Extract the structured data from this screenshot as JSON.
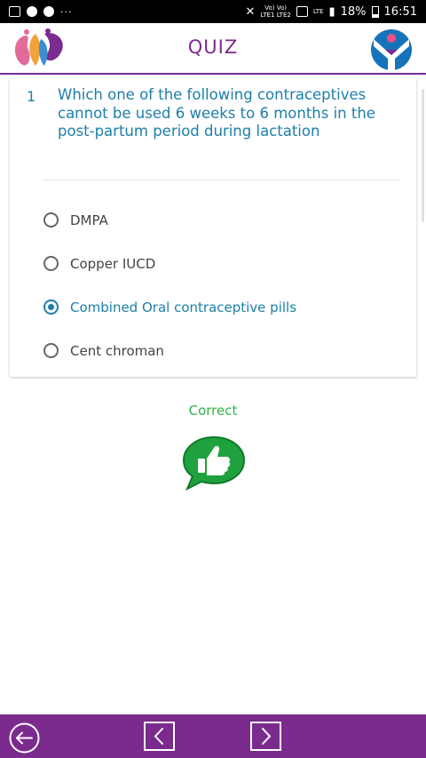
{
  "status_bar": {
    "network_top": "Vo) Vo)",
    "network_bottom": "LTE1 LTE2",
    "lte_label": "LTE",
    "battery": "18%",
    "time": "16:51"
  },
  "header": {
    "title": "QUIZ"
  },
  "question": {
    "number": "1",
    "text": "Which one of the following contraceptives cannot be used 6 weeks to 6 months in the post-partum period during lactation"
  },
  "options": [
    {
      "label": "DMPA",
      "selected": false
    },
    {
      "label": "Copper IUCD",
      "selected": false
    },
    {
      "label": "Combined Oral contraceptive pills",
      "selected": true
    },
    {
      "label": "Cent chroman",
      "selected": false
    }
  ],
  "result": {
    "text": "Correct"
  },
  "colors": {
    "brand_purple": "#7b2a8e",
    "question_blue": "#1d7fa8",
    "correct_green": "#33b44a"
  },
  "icons": {
    "back": "back-circle-arrow-icon",
    "prev": "chevron-left-box-icon",
    "next": "chevron-right-box-icon",
    "result": "thumbs-up-chat-bubble-icon"
  }
}
